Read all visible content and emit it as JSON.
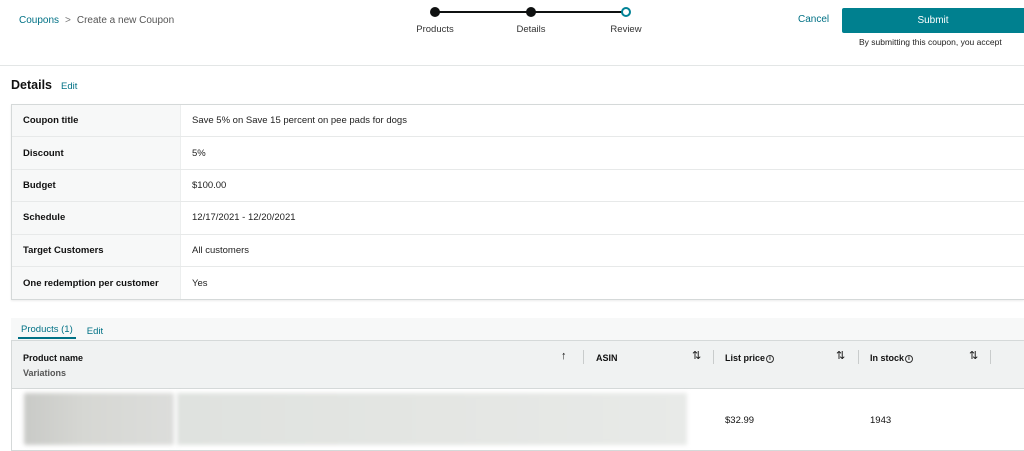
{
  "breadcrumb": {
    "root": "Coupons",
    "separator": ">",
    "current": "Create a new Coupon"
  },
  "stepper": {
    "steps": [
      {
        "label": "Products",
        "state": "complete"
      },
      {
        "label": "Details",
        "state": "complete"
      },
      {
        "label": "Review",
        "state": "current"
      }
    ]
  },
  "actions": {
    "cancel_label": "Cancel",
    "submit_label": "Submit",
    "submit_note": "By submitting this coupon, you accept"
  },
  "details": {
    "title": "Details",
    "edit_label": "Edit",
    "rows": [
      {
        "label": "Coupon title",
        "value": "Save 5% on Save 15 percent on pee pads for dogs"
      },
      {
        "label": "Discount",
        "value": "5%"
      },
      {
        "label": "Budget",
        "value": "$100.00"
      },
      {
        "label": "Schedule",
        "value": "12/17/2021 - 12/20/2021"
      },
      {
        "label": "Target Customers",
        "value": "All customers"
      },
      {
        "label": "One redemption per customer",
        "value": "Yes"
      }
    ]
  },
  "products": {
    "tab_label": "Products (1)",
    "edit_label": "Edit",
    "columns": {
      "product_name": "Product name",
      "variations": "Variations",
      "asin": "ASIN",
      "list_price": "List price",
      "in_stock": "In stock"
    },
    "rows": [
      {
        "list_price": "$32.99",
        "in_stock": "1943"
      }
    ]
  },
  "colors": {
    "accent": "#007185",
    "submit_bg": "#00808f"
  },
  "icons": {
    "breadcrumb_separator": "chevron-right-icon",
    "sort_ascending": "arrow-up-icon",
    "sort_toggle": "sort-up-down-icon",
    "info": "info-icon"
  }
}
